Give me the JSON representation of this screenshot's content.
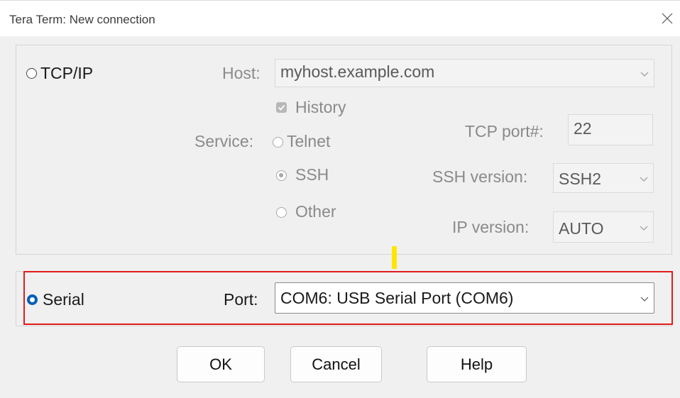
{
  "window": {
    "title": "Tera Term: New connection"
  },
  "tcpip": {
    "radio_label": "TCP/IP",
    "host_label": "Host:",
    "host_value": "myhost.example.com",
    "history_label": "History",
    "service_label": "Service:",
    "services": [
      "Telnet",
      "SSH",
      "Other"
    ],
    "tcp_port_label": "TCP port#:",
    "tcp_port_value": "22",
    "ssh_version_label": "SSH version:",
    "ssh_version_value": "SSH2",
    "ip_version_label": "IP version:",
    "ip_version_value": "AUTO"
  },
  "serial": {
    "radio_label": "Serial",
    "port_label": "Port:",
    "port_value": "COM6: USB Serial Port (COM6)"
  },
  "buttons": {
    "ok": "OK",
    "cancel": "Cancel",
    "help": "Help"
  },
  "colors": {
    "accent": "#005fb8",
    "highlight": "#e01b1b",
    "marker": "#ffe600"
  }
}
